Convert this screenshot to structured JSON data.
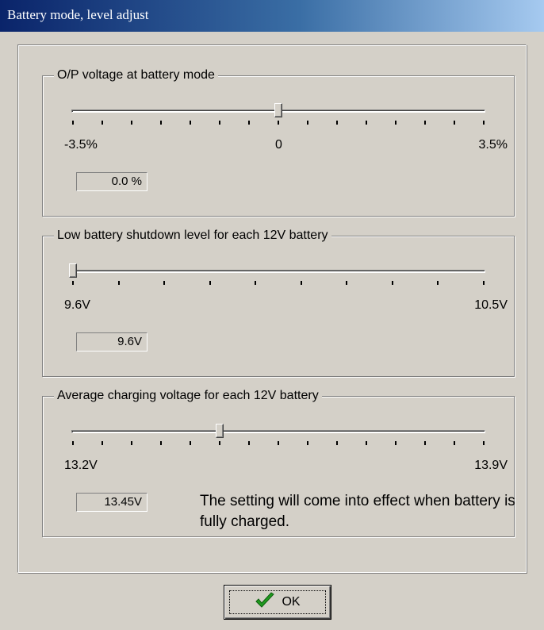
{
  "window": {
    "title": "Battery mode, level adjust"
  },
  "groups": [
    {
      "label": "O/P voltage at battery mode",
      "min_label": "-3.5%",
      "mid_label": "0",
      "max_label": "3.5%",
      "value_text": "0.0 %",
      "slider_position": 0.5,
      "tick_count": 15
    },
    {
      "label": "Low battery shutdown level for each 12V battery",
      "min_label": "9.6V",
      "max_label": "10.5V",
      "value_text": "9.6V",
      "slider_position": 0.0,
      "tick_count": 10
    },
    {
      "label": "Average charging voltage for each 12V battery",
      "min_label": "13.2V",
      "max_label": "13.9V",
      "value_text": "13.45V",
      "slider_position": 0.357,
      "tick_count": 15,
      "note": "The setting will come into effect when battery is fully charged."
    }
  ],
  "ok_button": {
    "label": "OK",
    "icon": "checkmark-icon",
    "icon_color": "#1f9a1f"
  }
}
